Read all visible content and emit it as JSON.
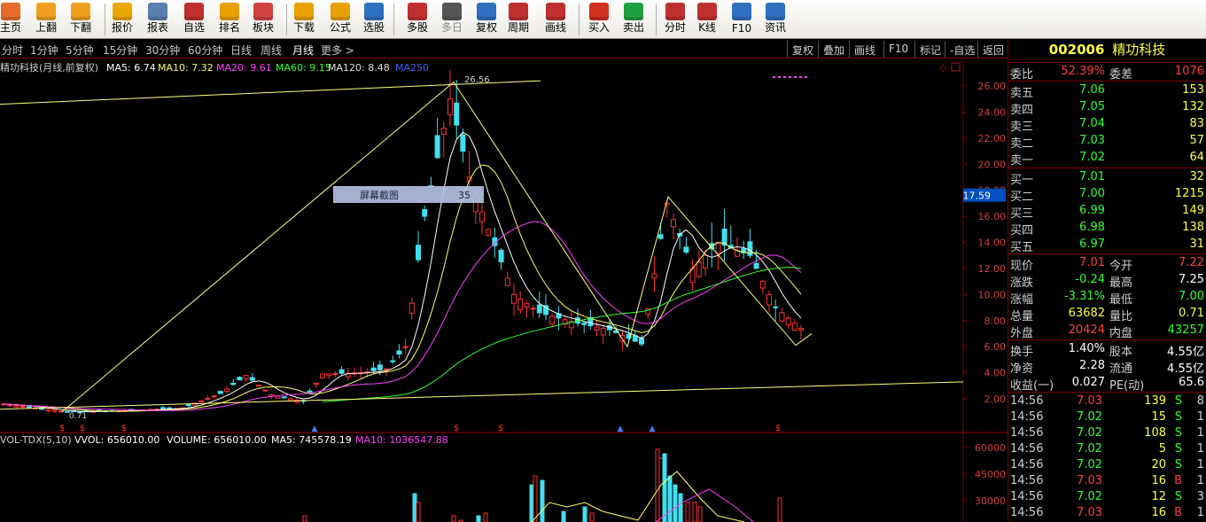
{
  "toolbar": [
    {
      "label": "主页",
      "icon": "home-icon",
      "color": "#e86b2a"
    },
    {
      "label": "上翻",
      "icon": "arrow-up-icon",
      "color": "#f0a020"
    },
    {
      "label": "下翻",
      "icon": "arrow-down-icon",
      "color": "#f0a020"
    },
    {
      "label": "报价",
      "icon": "yen-icon",
      "color": "#e8a800"
    },
    {
      "label": "报表",
      "icon": "report-icon",
      "color": "#5a7fb0"
    },
    {
      "label": "自选",
      "icon": "f6-icon",
      "color": "#c03030"
    },
    {
      "label": "排名",
      "icon": "ranking-icon",
      "color": "#e8a000"
    },
    {
      "label": "板块",
      "icon": "sector-grid-icon",
      "color": "#d04040"
    },
    {
      "label": "下载",
      "icon": "download-icon",
      "color": "#e8a000"
    },
    {
      "label": "公式",
      "icon": "formula-icon",
      "color": "#e8a000"
    },
    {
      "label": "选股",
      "icon": "stock-picker-icon",
      "color": "#3070c0"
    },
    {
      "label": "多股",
      "icon": "multi-stock-icon",
      "color": "#c03030"
    },
    {
      "label": "多日",
      "icon": "clock-icon",
      "color": "#555555"
    },
    {
      "label": "复权",
      "icon": "restore-rights-icon",
      "color": "#3070c0"
    },
    {
      "label": "周期",
      "icon": "f8-icon",
      "color": "#c03030"
    },
    {
      "label": "画线",
      "icon": "draw-line-icon",
      "color": "#c03030"
    },
    {
      "label": "买入",
      "icon": "buy-icon",
      "color": "#d03020"
    },
    {
      "label": "卖出",
      "icon": "sell-icon",
      "color": "#20a040"
    },
    {
      "label": "分时",
      "icon": "intraday-icon",
      "color": "#c03030"
    },
    {
      "label": "K线",
      "icon": "kline-icon",
      "color": "#c03030"
    },
    {
      "label": "F10",
      "icon": "f10-icon",
      "color": "#3070c0"
    },
    {
      "label": "资讯",
      "icon": "news-icon",
      "color": "#3070c0"
    }
  ],
  "periods": [
    "分时",
    "1分钟",
    "5分钟",
    "15分钟",
    "30分钟",
    "60分钟",
    "日线",
    "周线",
    "月线",
    "更多 >"
  ],
  "active_period": "月线",
  "chart_buttons": [
    "复权",
    "叠加",
    "画线",
    "F10",
    "标记",
    "-自选",
    "返回"
  ],
  "stock": {
    "code": "002006",
    "name": "精功科技"
  },
  "legend": {
    "name": "精功科技(月线,前复权)",
    "items": [
      {
        "text": "MA5: 6.74",
        "color": "#ffffff"
      },
      {
        "text": "MA10: 7.32",
        "color": "#ffff60"
      },
      {
        "text": "MA20: 9.61",
        "color": "#ff40ff"
      },
      {
        "text": "MA60: 9.15",
        "color": "#30ff30"
      },
      {
        "text": "MA120: 8.48",
        "color": "#e0e0e0"
      },
      {
        "text": "MA250",
        "color": "#4060ff"
      }
    ]
  },
  "price_axis": [
    "26.00",
    "24.00",
    "22.00",
    "20.00",
    "18.00",
    "16.00",
    "14.00",
    "12.00",
    "10.00",
    "8.00",
    "6.00",
    "4.00",
    "2.00"
  ],
  "current_price_marker": "17.59",
  "peak_label": "26.56",
  "low_label": "0.71",
  "overlay": {
    "label": "屏幕截图",
    "value": "35"
  },
  "volume_legend": {
    "name": "VOL-TDX(5,10)",
    "items": [
      {
        "text": "VVOL: 656010.00",
        "color": "#ffffff"
      },
      {
        "text": "VOLUME: 656010.00",
        "color": "#ffffff"
      },
      {
        "text": "MA5: 745578.19",
        "color": "#ffffff"
      },
      {
        "text": "MA10: 1036547.88",
        "color": "#ff40ff"
      }
    ]
  },
  "volume_axis": [
    "60000",
    "45000",
    "30000"
  ],
  "quote": {
    "weibi": {
      "label": "委比",
      "value": "52.39%",
      "label2": "委差",
      "value2": "1076"
    },
    "asks": [
      {
        "label": "卖五",
        "price": "7.06",
        "vol": "153"
      },
      {
        "label": "卖四",
        "price": "7.05",
        "vol": "132"
      },
      {
        "label": "卖三",
        "price": "7.04",
        "vol": "83"
      },
      {
        "label": "卖二",
        "price": "7.03",
        "vol": "57"
      },
      {
        "label": "卖一",
        "price": "7.02",
        "vol": "64"
      }
    ],
    "bids": [
      {
        "label": "买一",
        "price": "7.01",
        "vol": "32"
      },
      {
        "label": "买二",
        "price": "7.00",
        "vol": "1215"
      },
      {
        "label": "买三",
        "price": "6.99",
        "vol": "149"
      },
      {
        "label": "买四",
        "price": "6.98",
        "vol": "138"
      },
      {
        "label": "买五",
        "price": "6.97",
        "vol": "31"
      }
    ],
    "stats": [
      {
        "l1": "现价",
        "v1": "7.01",
        "c1": "#ff4040",
        "l2": "今开",
        "v2": "7.22",
        "c2": "#ff4040"
      },
      {
        "l1": "涨跌",
        "v1": "-0.24",
        "c1": "#30ff30",
        "l2": "最高",
        "v2": "7.25",
        "c2": "#ffffff"
      },
      {
        "l1": "涨幅",
        "v1": "-3.31%",
        "c1": "#30ff30",
        "l2": "最低",
        "v2": "7.00",
        "c2": "#30ff30"
      },
      {
        "l1": "总量",
        "v1": "63682",
        "c1": "#ffff40",
        "l2": "量比",
        "v2": "0.71",
        "c2": "#ffff40"
      },
      {
        "l1": "外盘",
        "v1": "20424",
        "c1": "#ff4040",
        "l2": "内盘",
        "v2": "43257",
        "c2": "#30ff30"
      }
    ],
    "fund": [
      {
        "l1": "换手",
        "v1": "1.40%",
        "l2": "股本",
        "v2": "4.55亿"
      },
      {
        "l1": "净资",
        "v1": "2.28",
        "l2": "流通",
        "v2": "4.55亿"
      },
      {
        "l1": "收益(一)",
        "v1": "0.027",
        "l2": "PE(动)",
        "v2": "65.6"
      }
    ],
    "ticks": [
      {
        "time": "14:56",
        "price": "7.03",
        "vol": "139",
        "side": "S",
        "n": "8"
      },
      {
        "time": "14:56",
        "price": "7.02",
        "vol": "15",
        "side": "S",
        "n": "1"
      },
      {
        "time": "14:56",
        "price": "7.02",
        "vol": "108",
        "side": "S",
        "n": "1"
      },
      {
        "time": "14:56",
        "price": "7.02",
        "vol": "5",
        "side": "S",
        "n": "1"
      },
      {
        "time": "14:56",
        "price": "7.02",
        "vol": "20",
        "side": "S",
        "n": "1"
      },
      {
        "time": "14:56",
        "price": "7.03",
        "vol": "16",
        "side": "B",
        "n": "1"
      },
      {
        "time": "14:56",
        "price": "7.02",
        "vol": "12",
        "side": "S",
        "n": "3"
      },
      {
        "time": "14:56",
        "price": "7.03",
        "vol": "16",
        "side": "B",
        "n": "1"
      }
    ]
  }
}
